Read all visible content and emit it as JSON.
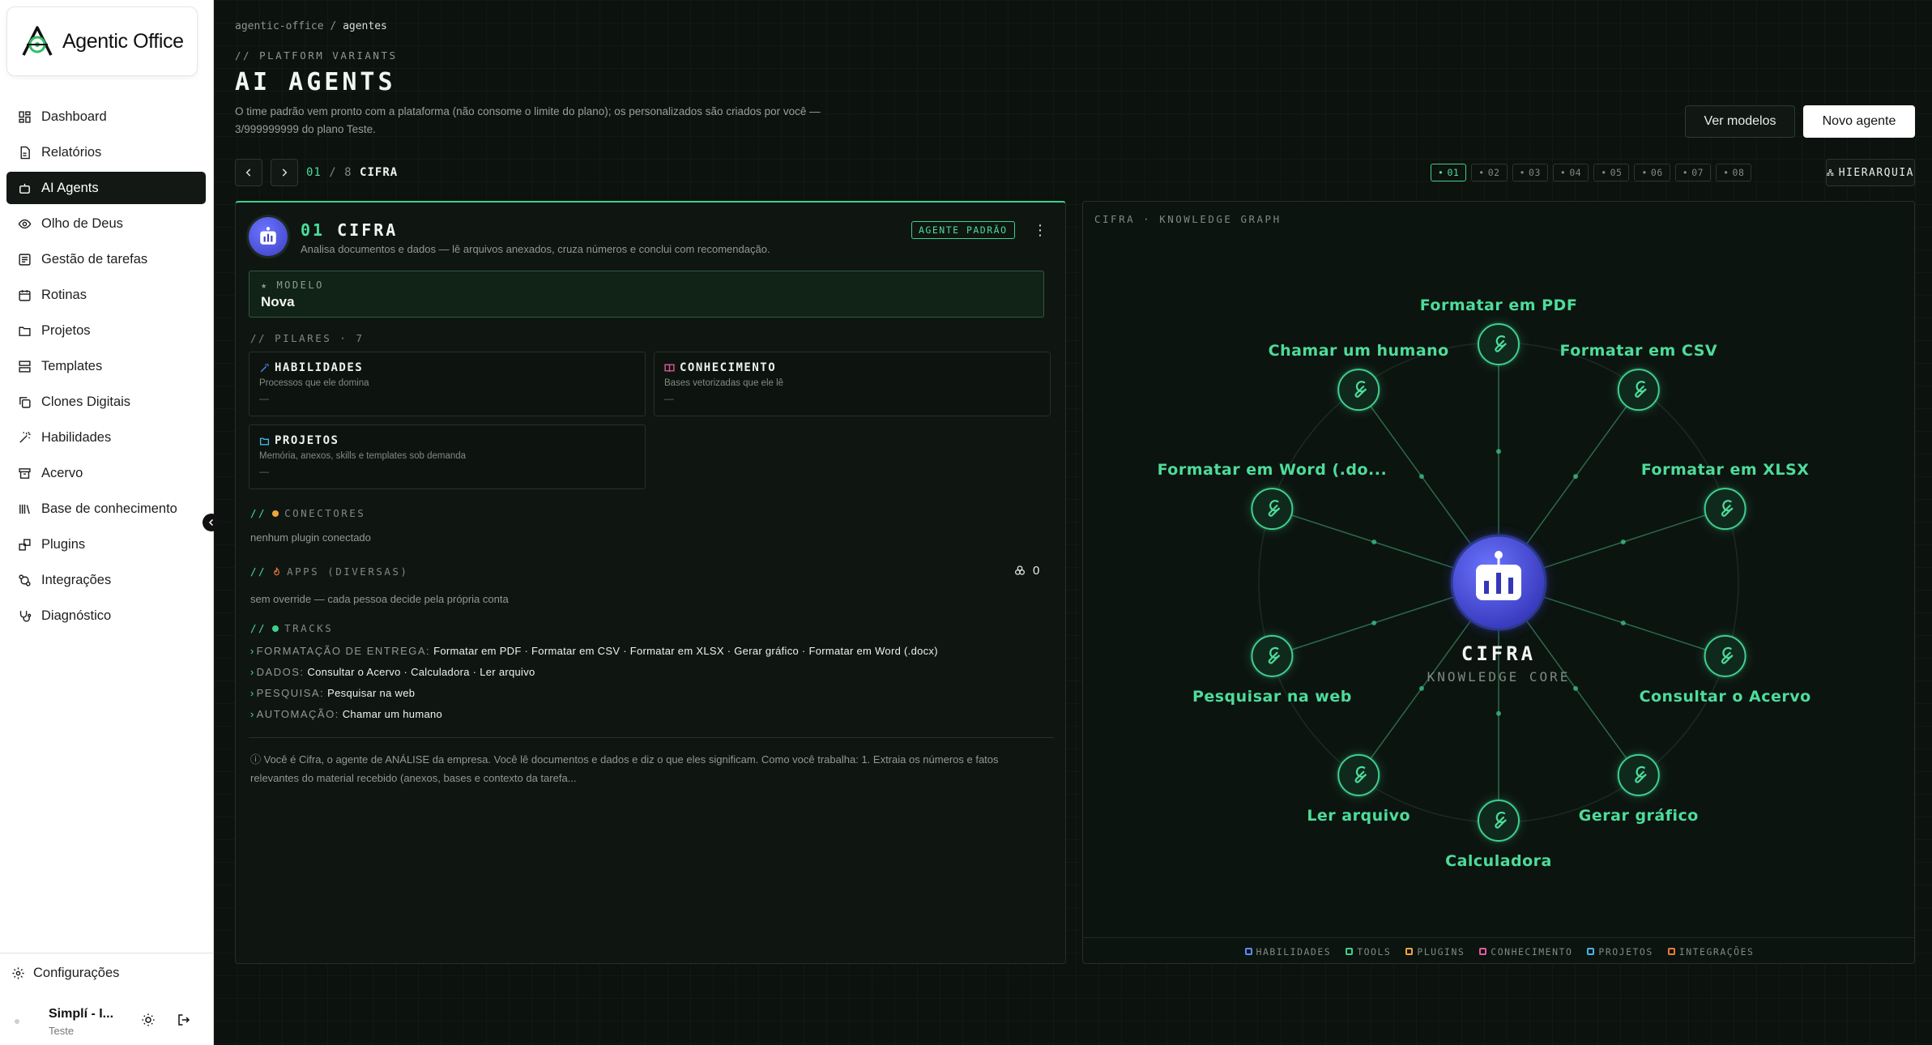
{
  "sidebar": {
    "logo_text": "Agentic Office",
    "items": [
      {
        "label": "Dashboard",
        "icon": "dashboard-icon"
      },
      {
        "label": "Relatórios",
        "icon": "report-icon"
      },
      {
        "label": "AI Agents",
        "icon": "robot-icon",
        "active": true
      },
      {
        "label": "Olho de Deus",
        "icon": "eye-icon"
      },
      {
        "label": "Gestão de tarefas",
        "icon": "task-icon"
      },
      {
        "label": "Rotinas",
        "icon": "calendar-icon"
      },
      {
        "label": "Projetos",
        "icon": "folder-icon"
      },
      {
        "label": "Templates",
        "icon": "template-icon"
      },
      {
        "label": "Clones Digitais",
        "icon": "clone-icon"
      },
      {
        "label": "Habilidades",
        "icon": "wand-icon"
      },
      {
        "label": "Acervo",
        "icon": "archive-icon"
      },
      {
        "label": "Base de conhecimento",
        "icon": "library-icon"
      },
      {
        "label": "Plugins",
        "icon": "plugin-icon"
      },
      {
        "label": "Integrações",
        "icon": "integration-icon"
      },
      {
        "label": "Diagnóstico",
        "icon": "stethoscope-icon"
      }
    ],
    "settings_label": "Configurações",
    "user": {
      "name": "Simplí - I...",
      "org": "Teste"
    }
  },
  "header": {
    "breadcrumb_root": "agentic-office",
    "breadcrumb_sep": "/",
    "breadcrumb_current": "agentes",
    "kicker": "// PLATFORM VARIANTS",
    "title": "AI AGENTS",
    "description": "O time padrão vem pronto com a plataforma (não consome o limite do plano); os personalizados são criados por você — 3/999999999 do plano Teste.",
    "btn_models": "Ver modelos",
    "btn_new": "Novo agente"
  },
  "pager": {
    "current": "01",
    "total": "/ 8",
    "name": "CIFRA",
    "chips": [
      "01",
      "02",
      "03",
      "04",
      "05",
      "06",
      "07",
      "08"
    ],
    "hierarchy_label": "HIERARQUIA"
  },
  "agent": {
    "number": "01",
    "name": "CIFRA",
    "description": "Analisa documentos e dados — lê arquivos anexados, cruza números e conclui com recomendação.",
    "badge": "AGENTE PADRÃO",
    "model_label": "★ MODELO",
    "model_value": "Nova",
    "pillars_heading": "// PILARES · 7",
    "pillars": [
      {
        "title": "HABILIDADES",
        "sub": "Processos que ele domina",
        "value": "—"
      },
      {
        "title": "CONHECIMENTO",
        "sub": "Bases vetorizadas que ele lê",
        "value": "—"
      },
      {
        "title": "PROJETOS",
        "sub": "Memória, anexos, skills e templates sob demanda",
        "value": "—"
      }
    ],
    "connectors_heading": "CONECTORES",
    "connectors_value": "nenhum plugin conectado",
    "apps_heading": "APPS (DIVERSAS)",
    "apps_count": "0",
    "apps_value": "sem override — cada pessoa decide pela própria conta",
    "tracks_heading": "TRACKS",
    "tracks": [
      {
        "key": "FORMATAÇÃO DE ENTREGA:",
        "value": "Formatar em PDF · Formatar em CSV · Formatar em XLSX · Gerar gráfico · Formatar em Word (.docx)"
      },
      {
        "key": "DADOS:",
        "value": "Consultar o Acervo · Calculadora · Ler arquivo"
      },
      {
        "key": "PESQUISA:",
        "value": "Pesquisar na web"
      },
      {
        "key": "AUTOMAÇÃO:",
        "value": "Chamar um humano"
      }
    ],
    "prompt": "ⓘ Você é Cifra, o agente de ANÁLISE da empresa. Você lê documentos e dados e diz o que eles significam. Como você trabalha: 1. Extraia os números e fatos relevantes do material recebido (anexos, bases e contexto da tarefa..."
  },
  "graph": {
    "title": "CIFRA · KNOWLEDGE GRAPH",
    "center_name": "CIFRA",
    "center_sub": "KNOWLEDGE CORE",
    "nodes": [
      {
        "label": "Formatar em PDF",
        "angle": -90
      },
      {
        "label": "Formatar em CSV",
        "angle": -54
      },
      {
        "label": "Formatar em XLSX",
        "angle": -18
      },
      {
        "label": "Consultar o Acervo",
        "angle": 18
      },
      {
        "label": "Gerar gráfico",
        "angle": 54
      },
      {
        "label": "Calculadora",
        "angle": 90
      },
      {
        "label": "Ler arquivo",
        "angle": 126
      },
      {
        "label": "Pesquisar na web",
        "angle": 162
      },
      {
        "label": "Formatar em Word (.do...",
        "angle": 198
      },
      {
        "label": "Chamar um humano",
        "angle": 234
      }
    ],
    "legend": [
      {
        "label": "HABILIDADES",
        "color": "#5b8cff"
      },
      {
        "label": "TOOLS",
        "color": "#3fcf8e"
      },
      {
        "label": "PLUGINS",
        "color": "#f0a53a"
      },
      {
        "label": "CONHECIMENTO",
        "color": "#e55a9a"
      },
      {
        "label": "PROJETOS",
        "color": "#45b5e8"
      },
      {
        "label": "INTEGRAÇÕES",
        "color": "#f07a3a"
      }
    ]
  }
}
